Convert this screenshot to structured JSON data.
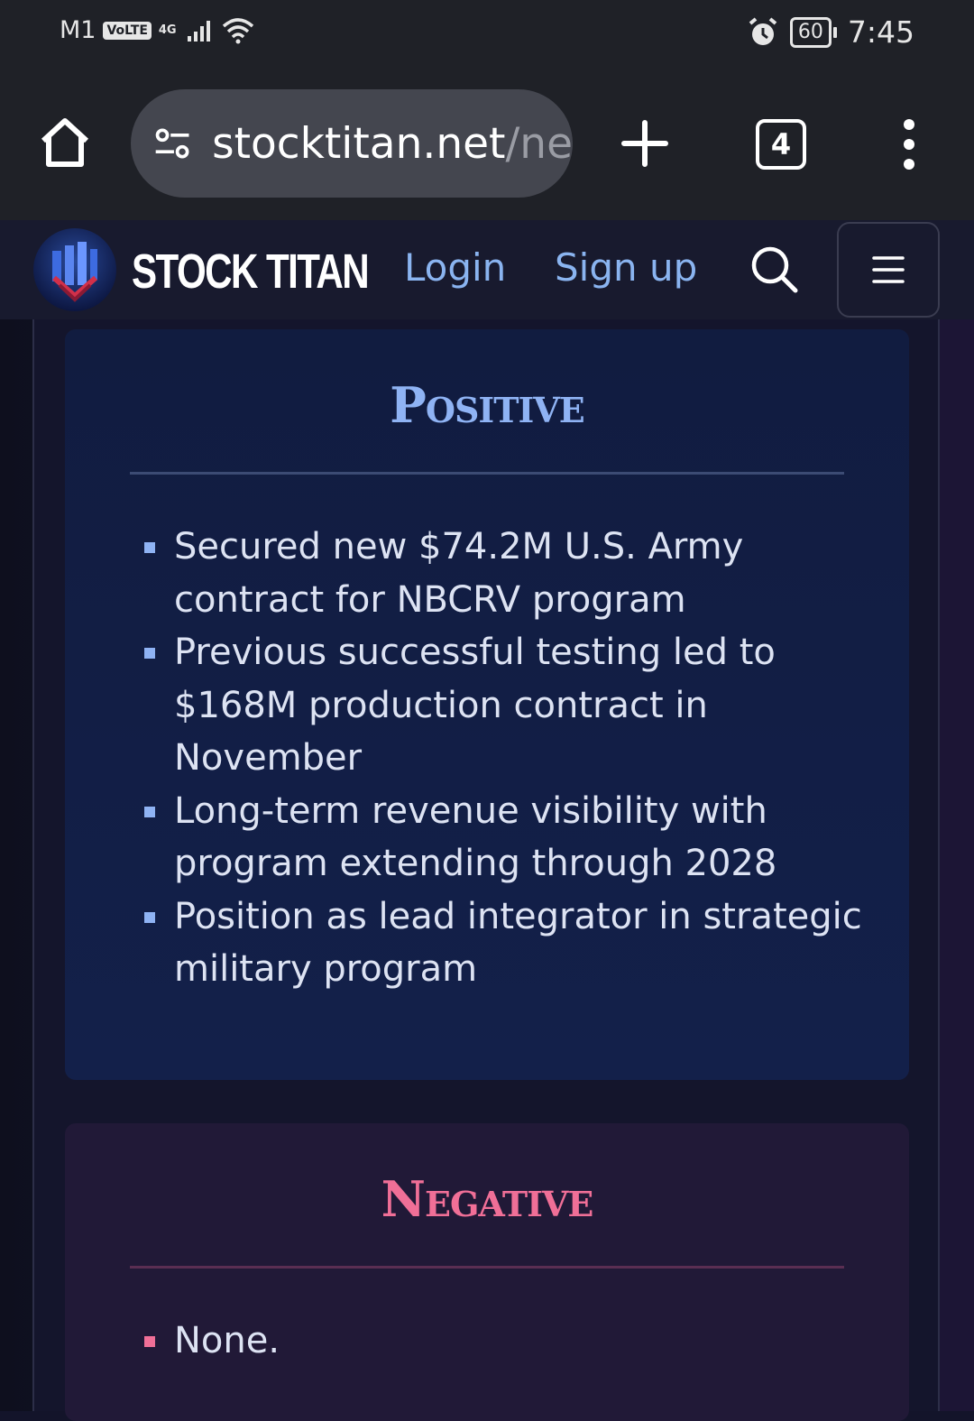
{
  "status_bar": {
    "carrier": "M1",
    "volte": "VoLTE",
    "network": "4G",
    "battery": "60",
    "time": "7:45"
  },
  "browser": {
    "url_main": "stocktitan.net",
    "url_rest": "/ne",
    "tab_count": "4"
  },
  "site_header": {
    "brand": "STOCK TITAN",
    "login": "Login",
    "signup": "Sign up"
  },
  "positive": {
    "title": "Positive",
    "items": [
      "Secured new $74.2M U.S. Army contract for NBCRV program",
      "Previous successful testing led to $168M production contract in November",
      "Long-term revenue visibility with program extending through 2028",
      "Position as lead integrator in strategic military program"
    ]
  },
  "negative": {
    "title": "Negative",
    "items": [
      "None."
    ]
  },
  "colors": {
    "positive_accent": "#8fb3f4",
    "negative_accent": "#f06f97",
    "link": "#8ab4f0"
  }
}
